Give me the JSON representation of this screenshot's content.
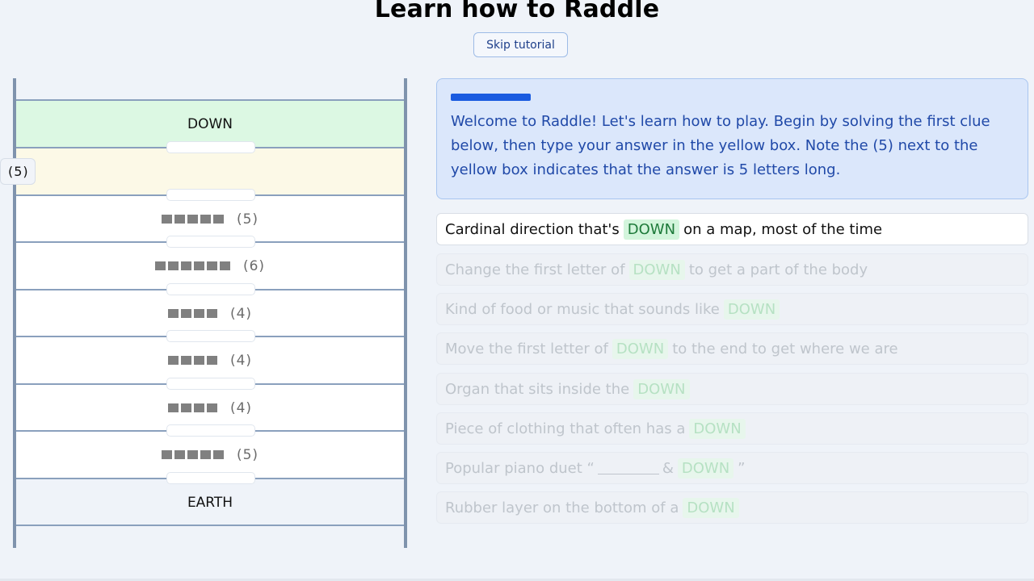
{
  "header": {
    "title": "Learn how to Raddle",
    "skip_label": "Skip tutorial"
  },
  "ladder": {
    "start_word": "DOWN",
    "end_word": "EARTH",
    "active_count": "(5)",
    "rungs": [
      {
        "count": "(5)",
        "squares": 5
      },
      {
        "count": "(6)",
        "squares": 6
      },
      {
        "count": "(4)",
        "squares": 4
      },
      {
        "count": "(4)",
        "squares": 4
      },
      {
        "count": "(4)",
        "squares": 4
      },
      {
        "count": "(5)",
        "squares": 5
      }
    ]
  },
  "intro": {
    "text": "Welcome to Raddle! Let's learn how to play. Begin by solving the first clue below, then type your answer in the yellow box. Note the (5) next to the yellow box indicates that the answer is 5 letters long.",
    "progress_fraction": 0.14
  },
  "clues": [
    {
      "before": "Cardinal direction that's",
      "word": "DOWN",
      "after": "on a map, most of the time",
      "state": "current"
    },
    {
      "before": "Change the first letter of",
      "word": "DOWN",
      "after": "to get a part of the body",
      "state": "future"
    },
    {
      "before": "Kind of food or music that sounds like",
      "word": "DOWN",
      "after": "",
      "state": "future"
    },
    {
      "before": "Move the first letter of",
      "word": "DOWN",
      "after": "to the end to get where we are",
      "state": "future"
    },
    {
      "before": "Organ that sits inside the",
      "word": "DOWN",
      "after": "",
      "state": "future"
    },
    {
      "before": "Piece of clothing that often has a",
      "word": "DOWN",
      "after": "",
      "state": "future"
    },
    {
      "before": "Popular piano duet “",
      "blank": true,
      "between": "&",
      "word": "DOWN",
      "after": "”",
      "state": "future"
    },
    {
      "before": "Rubber layer on the bottom of a",
      "word": "DOWN",
      "after": "",
      "state": "future"
    }
  ],
  "colors": {
    "accent": "#1a5be0",
    "start_rung": "#dcf8e3",
    "active_rung": "#fcf9e7",
    "word_green": "#1e7a3a"
  }
}
